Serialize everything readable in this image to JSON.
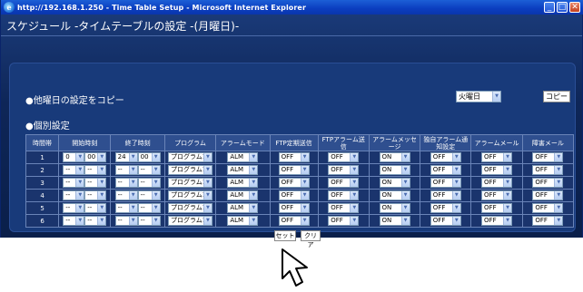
{
  "window": {
    "title": "http://192.168.1.250 - Time Table Setup - Microsoft Internet Explorer",
    "ie_glyph": "e",
    "min": "_",
    "max": "□",
    "close": "✕"
  },
  "page": {
    "title": "スケジュール -タイムテーブルの設定 -(月曜日)-"
  },
  "copy": {
    "label": "●他曜日の設定をコピー",
    "day_value": "火曜日",
    "copy_button": "コピー"
  },
  "individual": {
    "label": "●個別設定"
  },
  "table": {
    "headers": [
      "時間帯",
      "開始時刻",
      "終了時刻",
      "プログラム",
      "アラームモード",
      "FTP定期送信",
      "FTPアラーム送信",
      "アラームメッセージ",
      "独自アラーム通知設定",
      "アラームメール",
      "障害メール"
    ],
    "rows": [
      {
        "no": "1",
        "sh": "0",
        "sm": "00",
        "eh": "24",
        "em": "00",
        "program": "プログラム1",
        "mode": "ALM",
        "ftp": "OFF",
        "ftp_alarm": "OFF",
        "msg": "ON",
        "custom": "OFF",
        "mail": "OFF",
        "fail": "OFF"
      },
      {
        "no": "2",
        "sh": "--",
        "sm": "--",
        "eh": "--",
        "em": "--",
        "program": "プログラム1",
        "mode": "ALM",
        "ftp": "OFF",
        "ftp_alarm": "OFF",
        "msg": "ON",
        "custom": "OFF",
        "mail": "OFF",
        "fail": "OFF"
      },
      {
        "no": "3",
        "sh": "--",
        "sm": "--",
        "eh": "--",
        "em": "--",
        "program": "プログラム1",
        "mode": "ALM",
        "ftp": "OFF",
        "ftp_alarm": "OFF",
        "msg": "ON",
        "custom": "OFF",
        "mail": "OFF",
        "fail": "OFF"
      },
      {
        "no": "4",
        "sh": "--",
        "sm": "--",
        "eh": "--",
        "em": "--",
        "program": "プログラム1",
        "mode": "ALM",
        "ftp": "OFF",
        "ftp_alarm": "OFF",
        "msg": "ON",
        "custom": "OFF",
        "mail": "OFF",
        "fail": "OFF"
      },
      {
        "no": "5",
        "sh": "--",
        "sm": "--",
        "eh": "--",
        "em": "--",
        "program": "プログラム1",
        "mode": "ALM",
        "ftp": "OFF",
        "ftp_alarm": "OFF",
        "msg": "ON",
        "custom": "OFF",
        "mail": "OFF",
        "fail": "OFF"
      },
      {
        "no": "6",
        "sh": "--",
        "sm": "--",
        "eh": "--",
        "em": "--",
        "program": "プログラム1",
        "mode": "ALM",
        "ftp": "OFF",
        "ftp_alarm": "OFF",
        "msg": "ON",
        "custom": "OFF",
        "mail": "OFF",
        "fail": "OFF"
      }
    ]
  },
  "buttons": {
    "set": "セット",
    "clear": "クリア"
  },
  "colors": {
    "titlebar": "#0b3dbf",
    "page_bg": "#0e2658",
    "table_header": "#2f4f8f"
  },
  "icons": {
    "dropdown": "chevron-down-icon",
    "cursor": "mouse-pointer-icon"
  }
}
